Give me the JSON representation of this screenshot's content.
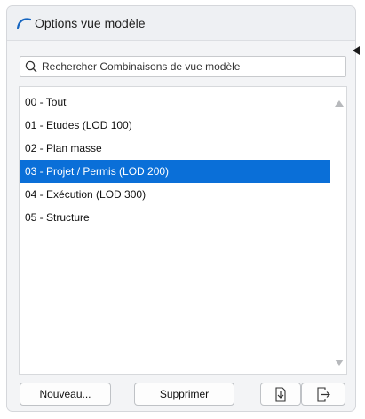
{
  "panel": {
    "title": "Options vue modèle",
    "title_icon": "arch-icon",
    "collapse_icon": "triangle-left-icon"
  },
  "search": {
    "placeholder": "Rechercher Combinaisons de vue modèle"
  },
  "list": {
    "items": [
      {
        "label": "00 - Tout",
        "selected": false
      },
      {
        "label": "01 - Etudes (LOD 100)",
        "selected": false
      },
      {
        "label": "02 - Plan masse",
        "selected": false
      },
      {
        "label": "03 - Projet / Permis (LOD 200)",
        "selected": true
      },
      {
        "label": "04 - Exécution (LOD 300)",
        "selected": false
      },
      {
        "label": "05 - Structure",
        "selected": false
      }
    ]
  },
  "buttons": {
    "new_label": "Nouveau...",
    "delete_label": "Supprimer",
    "import_icon": "import-icon",
    "export_icon": "export-icon"
  },
  "colors": {
    "selection": "#0a6fd8",
    "title_icon": "#1565c0"
  }
}
